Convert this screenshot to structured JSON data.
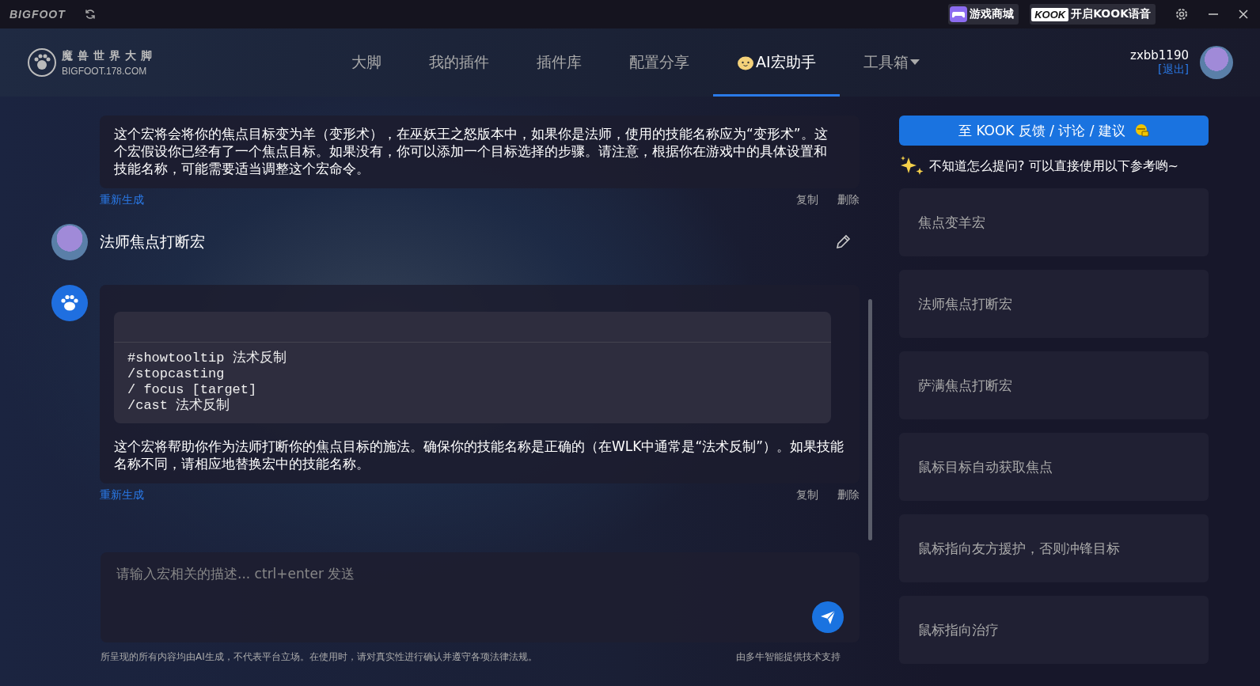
{
  "titlebar": {
    "brand": "BIGFOOT",
    "store_button": "游戏商城",
    "kook_logo": "KOOK",
    "kook_button": "开启KOOK语音"
  },
  "logo": {
    "title": "魔兽世界大脚",
    "subtitle": "BIGFOOT.178.COM"
  },
  "nav": [
    {
      "label": "大脚",
      "selected": false,
      "kind": "plain"
    },
    {
      "label": "我的插件",
      "selected": false,
      "kind": "plain"
    },
    {
      "label": "插件库",
      "selected": false,
      "kind": "plain"
    },
    {
      "label": "配置分享",
      "selected": false,
      "kind": "plain"
    },
    {
      "label": "AI宏助手",
      "selected": true,
      "kind": "emoji"
    },
    {
      "label": "工具箱",
      "selected": false,
      "kind": "dropdown"
    }
  ],
  "user": {
    "name": "zxbb1190",
    "logout": "[退出]"
  },
  "chat": [
    {
      "kind": "answer",
      "avatar": false,
      "text": "这个宏将会将你的焦点目标变为羊（变形术），在巫妖王之怒版本中，如果你是法师，使用的技能名称应为“变形术”。这个宏假设你已经有了一个焦点目标。如果没有，你可以添加一个目标选择的步骤。请注意，根据你在游戏中的具体设置和技能名称，可能需要适当调整这个宏命令。",
      "regenerate": "重新生成",
      "copy": "复制",
      "delete": "删除"
    },
    {
      "kind": "question",
      "text": "法师焦点打断宏"
    },
    {
      "kind": "answer",
      "avatar": true,
      "code": [
        "#showtooltip 法术反制",
        "/stopcasting",
        "/ focus [target]",
        "/cast 法术反制"
      ],
      "text": "这个宏将帮助你作为法师打断你的焦点目标的施法。确保你的技能名称是正确的（在WLK中通常是“法术反制”）。如果技能名称不同，请相应地替换宏中的技能名称。",
      "regenerate": "重新生成",
      "copy": "复制",
      "delete": "删除"
    }
  ],
  "input": {
    "placeholder": "请输入宏相关的描述... ctrl+enter 发送"
  },
  "footer": {
    "disclaimer": "所呈现的所有内容均由AI生成，不代表平台立场。在使用时，请对真实性进行确认并遵守各项法律法规。",
    "credit": "由多牛智能提供技术支持"
  },
  "sidebar": {
    "feedback_button": "至 KOOK 反馈 / 讨论 / 建议",
    "hint": "不知道怎么提问? 可以直接使用以下参考哟~",
    "suggestions": [
      "焦点变羊宏",
      "法师焦点打断宏",
      "萨满焦点打断宏",
      "鼠标目标自动获取焦点",
      "鼠标指向友方援护，否则冲锋目标",
      "鼠标指向治疗"
    ]
  }
}
